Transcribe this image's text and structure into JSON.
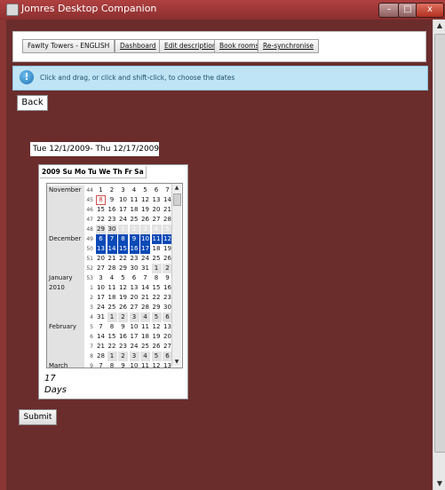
{
  "window": {
    "title": "Jomres Desktop Companion",
    "minimize": "–",
    "maximize": "□",
    "close": "x"
  },
  "nav": {
    "property": "Fawlty Towers - ENGLISH",
    "dashboard": "Dashboard",
    "edit_description": "Edit description",
    "book_rooms": "Book rooms",
    "resync": "Re-synchronise"
  },
  "info": {
    "icon": "!",
    "message": "Click and drag, or click and shift-click, to choose the dates"
  },
  "back_label": "Back",
  "date_range": "Tue 12/1/2009- Thu 12/17/2009",
  "calendar": {
    "year_tab": "2009",
    "dow": [
      "Su",
      "Mo",
      "Tu",
      "We",
      "Th",
      "Fr",
      "Sa"
    ],
    "rows": [
      {
        "month": "November",
        "week": "44",
        "days": [
          "1",
          "2",
          "3",
          "4",
          "5",
          "6",
          "7"
        ]
      },
      {
        "month": "",
        "week": "45",
        "days": [
          "8",
          "9",
          "10",
          "11",
          "12",
          "13",
          "14"
        ]
      },
      {
        "month": "",
        "week": "46",
        "days": [
          "15",
          "16",
          "17",
          "18",
          "19",
          "20",
          "21"
        ]
      },
      {
        "month": "",
        "week": "47",
        "days": [
          "22",
          "23",
          "24",
          "25",
          "26",
          "27",
          "28"
        ]
      },
      {
        "month": "",
        "week": "48",
        "days": [
          "29",
          "30",
          "1",
          "2",
          "3",
          "4",
          "5"
        ]
      },
      {
        "month": "December",
        "week": "49",
        "days": [
          "6",
          "7",
          "8",
          "9",
          "10",
          "11",
          "12"
        ]
      },
      {
        "month": "",
        "week": "50",
        "days": [
          "13",
          "14",
          "15",
          "16",
          "17",
          "18",
          "19"
        ]
      },
      {
        "month": "",
        "week": "51",
        "days": [
          "20",
          "21",
          "22",
          "23",
          "24",
          "25",
          "26"
        ]
      },
      {
        "month": "",
        "week": "52",
        "days": [
          "27",
          "28",
          "29",
          "30",
          "31",
          "1",
          "2"
        ]
      },
      {
        "month": "January",
        "week": "53",
        "days": [
          "3",
          "4",
          "5",
          "6",
          "7",
          "8",
          "9"
        ]
      },
      {
        "month": "2010",
        "week": "1",
        "days": [
          "10",
          "11",
          "12",
          "13",
          "14",
          "15",
          "16"
        ]
      },
      {
        "month": "",
        "week": "2",
        "days": [
          "17",
          "18",
          "19",
          "20",
          "21",
          "22",
          "23"
        ]
      },
      {
        "month": "",
        "week": "3",
        "days": [
          "24",
          "25",
          "26",
          "27",
          "28",
          "29",
          "30"
        ]
      },
      {
        "month": "",
        "week": "4",
        "days": [
          "31",
          "1",
          "2",
          "3",
          "4",
          "5",
          "6"
        ]
      },
      {
        "month": "February",
        "week": "5",
        "days": [
          "7",
          "8",
          "9",
          "10",
          "11",
          "12",
          "13"
        ]
      },
      {
        "month": "",
        "week": "6",
        "days": [
          "14",
          "15",
          "16",
          "17",
          "18",
          "19",
          "20"
        ]
      },
      {
        "month": "",
        "week": "7",
        "days": [
          "21",
          "22",
          "23",
          "24",
          "25",
          "26",
          "27"
        ]
      },
      {
        "month": "",
        "week": "8",
        "days": [
          "28",
          "1",
          "2",
          "3",
          "4",
          "5",
          "6"
        ]
      },
      {
        "month": "March",
        "week": "9",
        "days": [
          "7",
          "8",
          "9",
          "10",
          "11",
          "12",
          "13"
        ]
      }
    ],
    "selected": [
      [
        4,
        2
      ],
      [
        4,
        3
      ],
      [
        4,
        4
      ],
      [
        4,
        5
      ],
      [
        4,
        6
      ],
      [
        5,
        0
      ],
      [
        5,
        1
      ],
      [
        5,
        2
      ],
      [
        5,
        3
      ],
      [
        5,
        4
      ],
      [
        5,
        5
      ],
      [
        5,
        6
      ],
      [
        6,
        0
      ],
      [
        6,
        1
      ],
      [
        6,
        2
      ],
      [
        6,
        3
      ],
      [
        6,
        4
      ]
    ],
    "today": [
      1,
      0
    ],
    "gray_rows": [
      4,
      8,
      13,
      17
    ],
    "gray_cols_start": {
      "4": 0,
      "8": 5,
      "13": 1,
      "17": 1
    },
    "colors": {
      "selection": "#0a4ab7",
      "background": "#6b2c2c"
    }
  },
  "num_days": "17",
  "days_word": "Days",
  "submit_label": "Submit"
}
